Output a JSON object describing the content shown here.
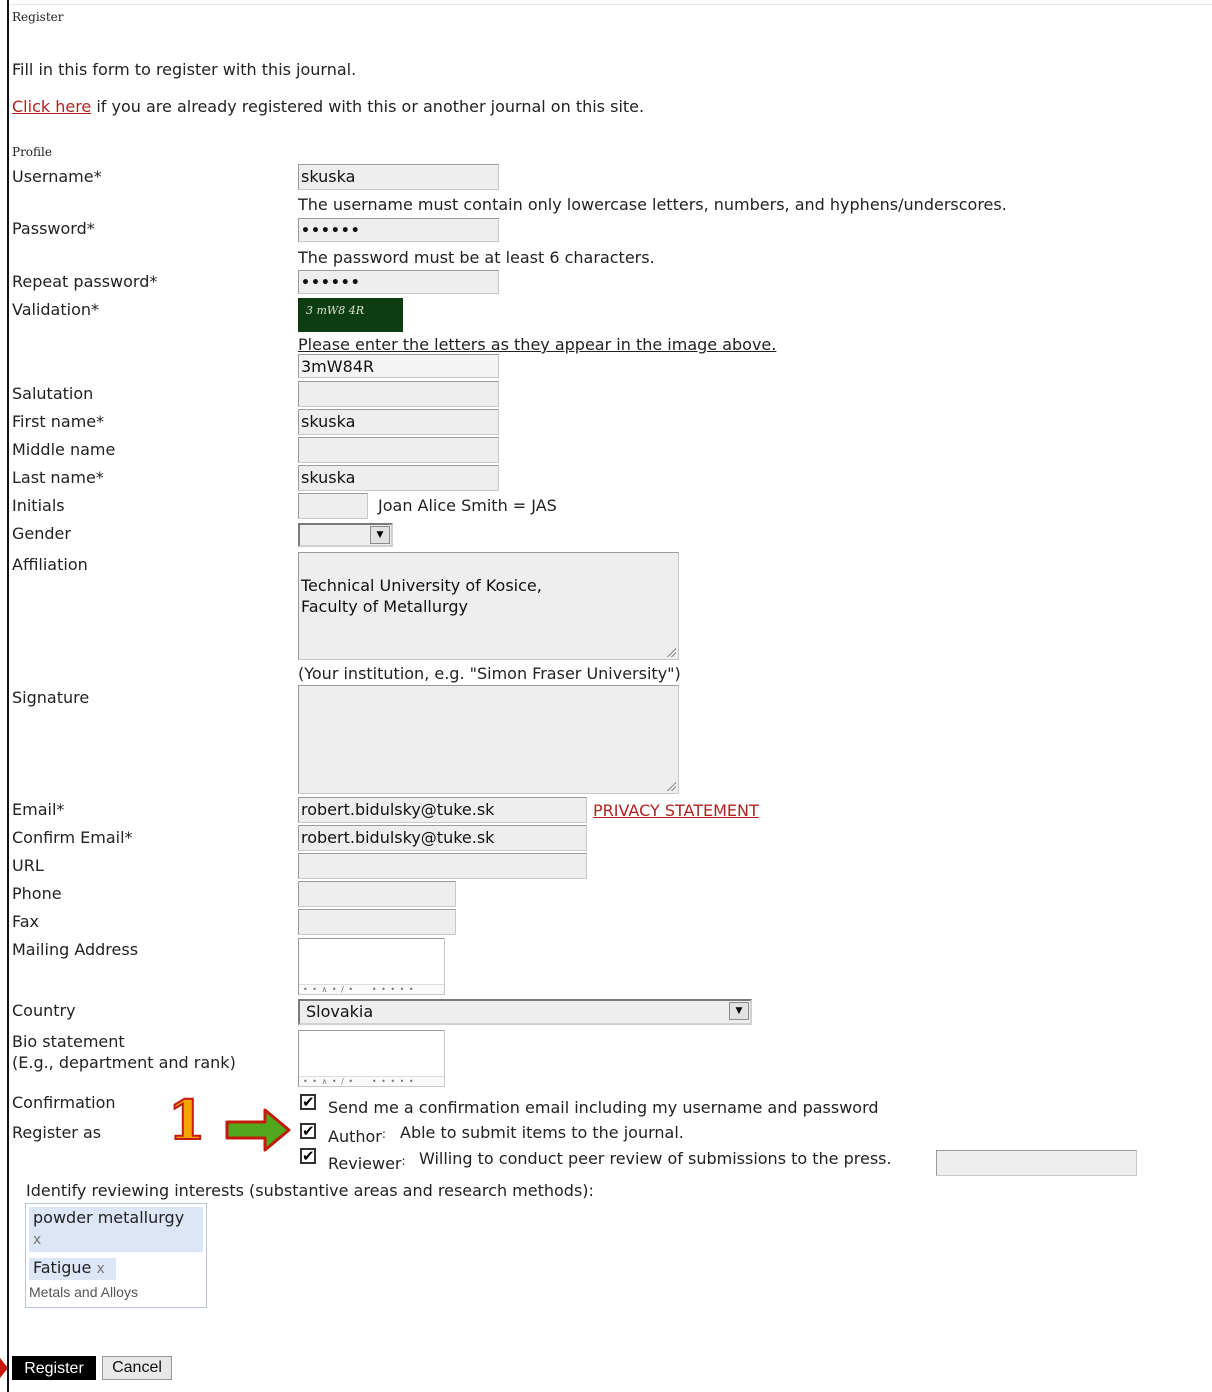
{
  "page_title": "Register",
  "intro_text": "Fill in this form to register with this journal.",
  "login_link": {
    "link_text": "Click here",
    "rest_text": " if you are already registered with this or another journal on this site."
  },
  "section_title": "Profile",
  "fields": {
    "username": {
      "label": "Username*",
      "value": "skuska",
      "hint": "The username must contain only lowercase letters, numbers, and hyphens/underscores."
    },
    "password": {
      "label": "Password*",
      "value": "••••••",
      "hint": "The password must be at least 6 characters."
    },
    "repeat_password": {
      "label": "Repeat password*",
      "value": "••••••"
    },
    "validation": {
      "label": "Validation*",
      "captcha_text": "3 mW8 4R",
      "hint": "Please enter the letters as they appear in the image above.",
      "value": "3mW84R"
    },
    "salutation": {
      "label": "Salutation",
      "value": ""
    },
    "first_name": {
      "label": "First name*",
      "value": "skuska"
    },
    "middle_name": {
      "label": "Middle name",
      "value": ""
    },
    "last_name": {
      "label": "Last name*",
      "value": "skuska"
    },
    "initials": {
      "label": "Initials",
      "value": "",
      "hint": "Joan Alice Smith = JAS"
    },
    "gender": {
      "label": "Gender",
      "value": ""
    },
    "affiliation": {
      "label": "Affiliation",
      "value": "Technical University of Kosice,\nFaculty of Metallurgy",
      "hint": "(Your institution, e.g. \"Simon Fraser University\")"
    },
    "signature": {
      "label": "Signature",
      "value": ""
    },
    "email": {
      "label": "Email*",
      "value": "robert.bidulsky@tuke.sk",
      "privacy_link": "PRIVACY STATEMENT"
    },
    "confirm_email": {
      "label": "Confirm Email*",
      "value": "robert.bidulsky@tuke.sk"
    },
    "url": {
      "label": "URL",
      "value": ""
    },
    "phone": {
      "label": "Phone",
      "value": ""
    },
    "fax": {
      "label": "Fax",
      "value": ""
    },
    "mailing_address": {
      "label": "Mailing Address",
      "value": "",
      "toolbar": "• • ∧ • / •     • • • • •"
    },
    "country": {
      "label": "Country",
      "value": "Slovakia"
    },
    "bio": {
      "label_line1": "Bio statement",
      "label_line2": "(E.g., department and rank)",
      "value": "",
      "toolbar": "• • ∧ • / •     • • • • •"
    },
    "confirmation": {
      "label": "Confirmation",
      "checked": true,
      "text": "Send me a confirmation email including my username and password"
    },
    "register_as": {
      "label": "Register as",
      "author": {
        "checked": true,
        "role": "Author",
        "desc": "Able to submit items to the journal."
      },
      "reviewer": {
        "checked": true,
        "role": "Reviewer",
        "desc": "Willing to conduct peer review of submissions to the press.",
        "value": ""
      }
    }
  },
  "reviewing_interests": {
    "label": "Identify reviewing interests (substantive areas and research methods):",
    "tags": [
      "powder metallurgy",
      "Fatigue"
    ],
    "remove_glyph": "x",
    "input_value": "Metals and Alloys"
  },
  "buttons": {
    "register": "Register",
    "cancel": "Cancel"
  },
  "annotation": {
    "number": "1",
    "color": "#f4a300",
    "outline": "#c41a0e",
    "arrow_fill": "#52a81c",
    "arrow_outline": "#c41a0e"
  },
  "check_glyph": "✔",
  "dropdown_glyph": "▼"
}
